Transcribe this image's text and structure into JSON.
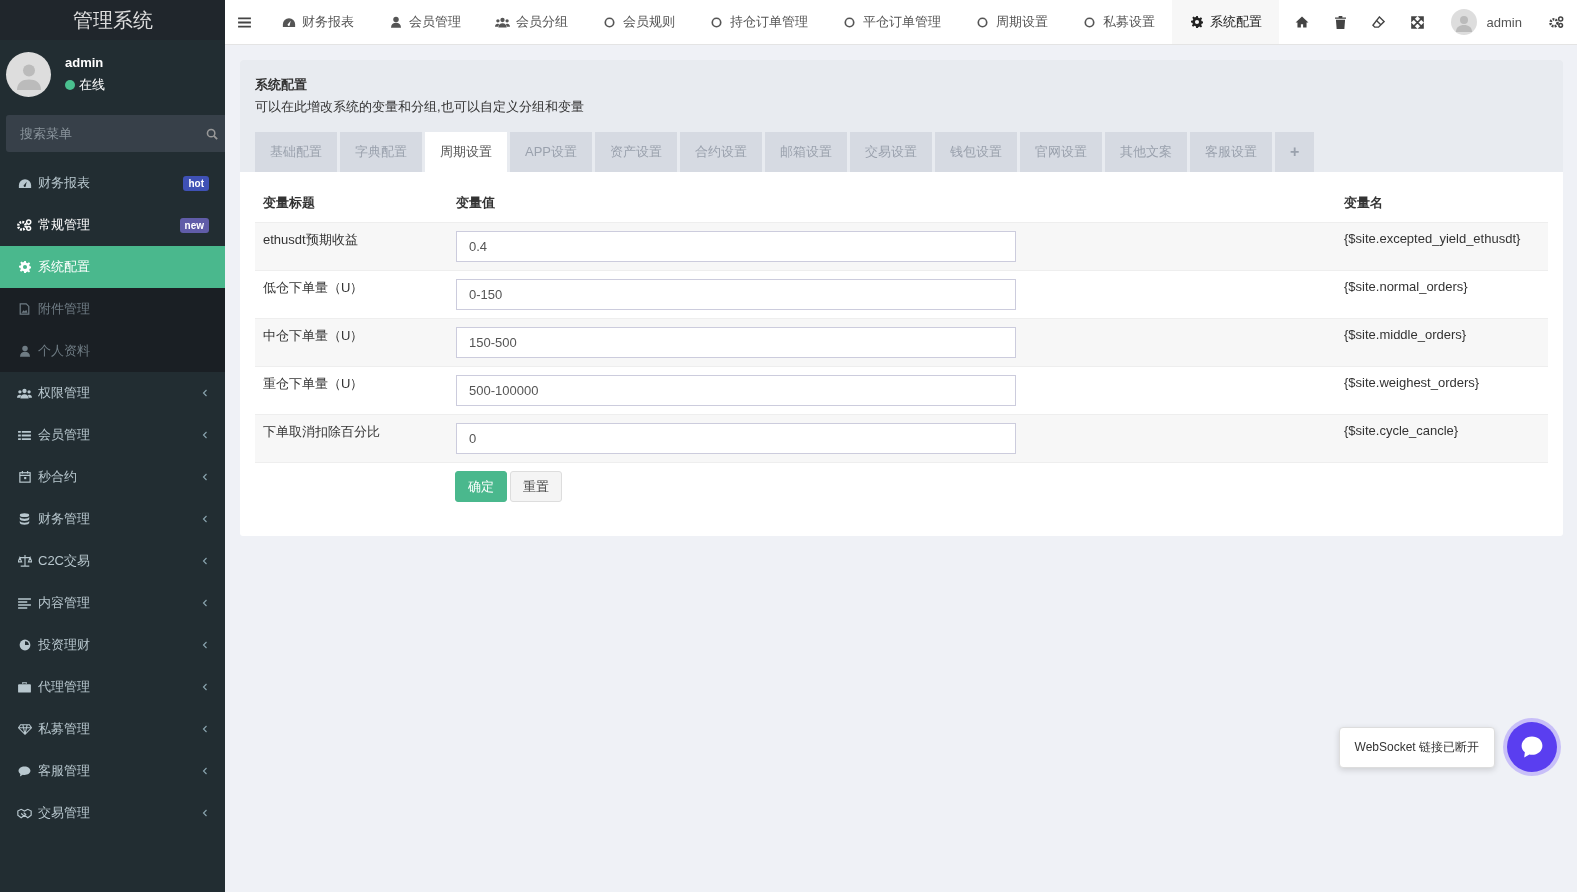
{
  "sidebar": {
    "brand": "管理系统",
    "user": {
      "name": "admin",
      "status": "在线"
    },
    "search": {
      "placeholder": "搜索菜单"
    },
    "menu": [
      {
        "label": "财务报表",
        "kind": "link",
        "badge": {
          "text": "hot",
          "color": "#3f51b5"
        }
      },
      {
        "label": "常规管理",
        "kind": "group",
        "expanded": true,
        "badge": {
          "text": "new",
          "color": "#605ca8"
        },
        "children": [
          {
            "label": "系统配置",
            "selected": true
          },
          {
            "label": "附件管理",
            "selected": false
          },
          {
            "label": "个人资料",
            "selected": false
          }
        ]
      },
      {
        "label": "权限管理",
        "kind": "group",
        "expanded": false
      },
      {
        "label": "会员管理",
        "kind": "group",
        "expanded": false
      },
      {
        "label": "秒合约",
        "kind": "group",
        "expanded": false
      },
      {
        "label": "财务管理",
        "kind": "group",
        "expanded": false
      },
      {
        "label": "C2C交易",
        "kind": "group",
        "expanded": false
      },
      {
        "label": "内容管理",
        "kind": "group",
        "expanded": false
      },
      {
        "label": "投资理财",
        "kind": "group",
        "expanded": false
      },
      {
        "label": "代理管理",
        "kind": "group",
        "expanded": false
      },
      {
        "label": "私募管理",
        "kind": "group",
        "expanded": false
      },
      {
        "label": "客服管理",
        "kind": "group",
        "expanded": false
      },
      {
        "label": "交易管理",
        "kind": "group",
        "expanded": false
      }
    ]
  },
  "topbar": {
    "tabs": [
      {
        "label": "财务报表",
        "selected": false
      },
      {
        "label": "会员管理",
        "selected": false
      },
      {
        "label": "会员分组",
        "selected": false
      },
      {
        "label": "会员规则",
        "selected": false
      },
      {
        "label": "持仓订单管理",
        "selected": false
      },
      {
        "label": "平仓订单管理",
        "selected": false
      },
      {
        "label": "周期设置",
        "selected": false
      },
      {
        "label": "私募设置",
        "selected": false
      },
      {
        "label": "系统配置",
        "selected": true
      }
    ],
    "user": "admin"
  },
  "panel": {
    "title": "系统配置",
    "description": "可以在此增改系统的变量和分组,也可以自定义分组和变量",
    "tabs": [
      {
        "label": "基础配置",
        "selected": false
      },
      {
        "label": "字典配置",
        "selected": false
      },
      {
        "label": "周期设置",
        "selected": true
      },
      {
        "label": "APP设置",
        "selected": false
      },
      {
        "label": "资产设置",
        "selected": false
      },
      {
        "label": "合约设置",
        "selected": false
      },
      {
        "label": "邮箱设置",
        "selected": false
      },
      {
        "label": "交易设置",
        "selected": false
      },
      {
        "label": "钱包设置",
        "selected": false
      },
      {
        "label": "官网设置",
        "selected": false
      },
      {
        "label": "其他文案",
        "selected": false
      },
      {
        "label": "客服设置",
        "selected": false
      }
    ],
    "add_tab": "+",
    "table": {
      "columns": [
        "变量标题",
        "变量值",
        "变量名"
      ],
      "rows": [
        {
          "title": "ethusdt预期收益",
          "value": "0.4",
          "name": "{$site.excepted_yield_ethusdt}"
        },
        {
          "title": "低仓下单量（U）",
          "value": "0-150",
          "name": "{$site.normal_orders}"
        },
        {
          "title": "中仓下单量（U）",
          "value": "150-500",
          "name": "{$site.middle_orders}"
        },
        {
          "title": "重仓下单量（U）",
          "value": "500-100000",
          "name": "{$site.weighest_orders}"
        },
        {
          "title": "下单取消扣除百分比",
          "value": "0",
          "name": "{$site.cycle_cancle}"
        }
      ]
    },
    "buttons": {
      "submit": "确定",
      "reset": "重置"
    }
  },
  "toast": {
    "message": "WebSocket 链接已断开"
  }
}
